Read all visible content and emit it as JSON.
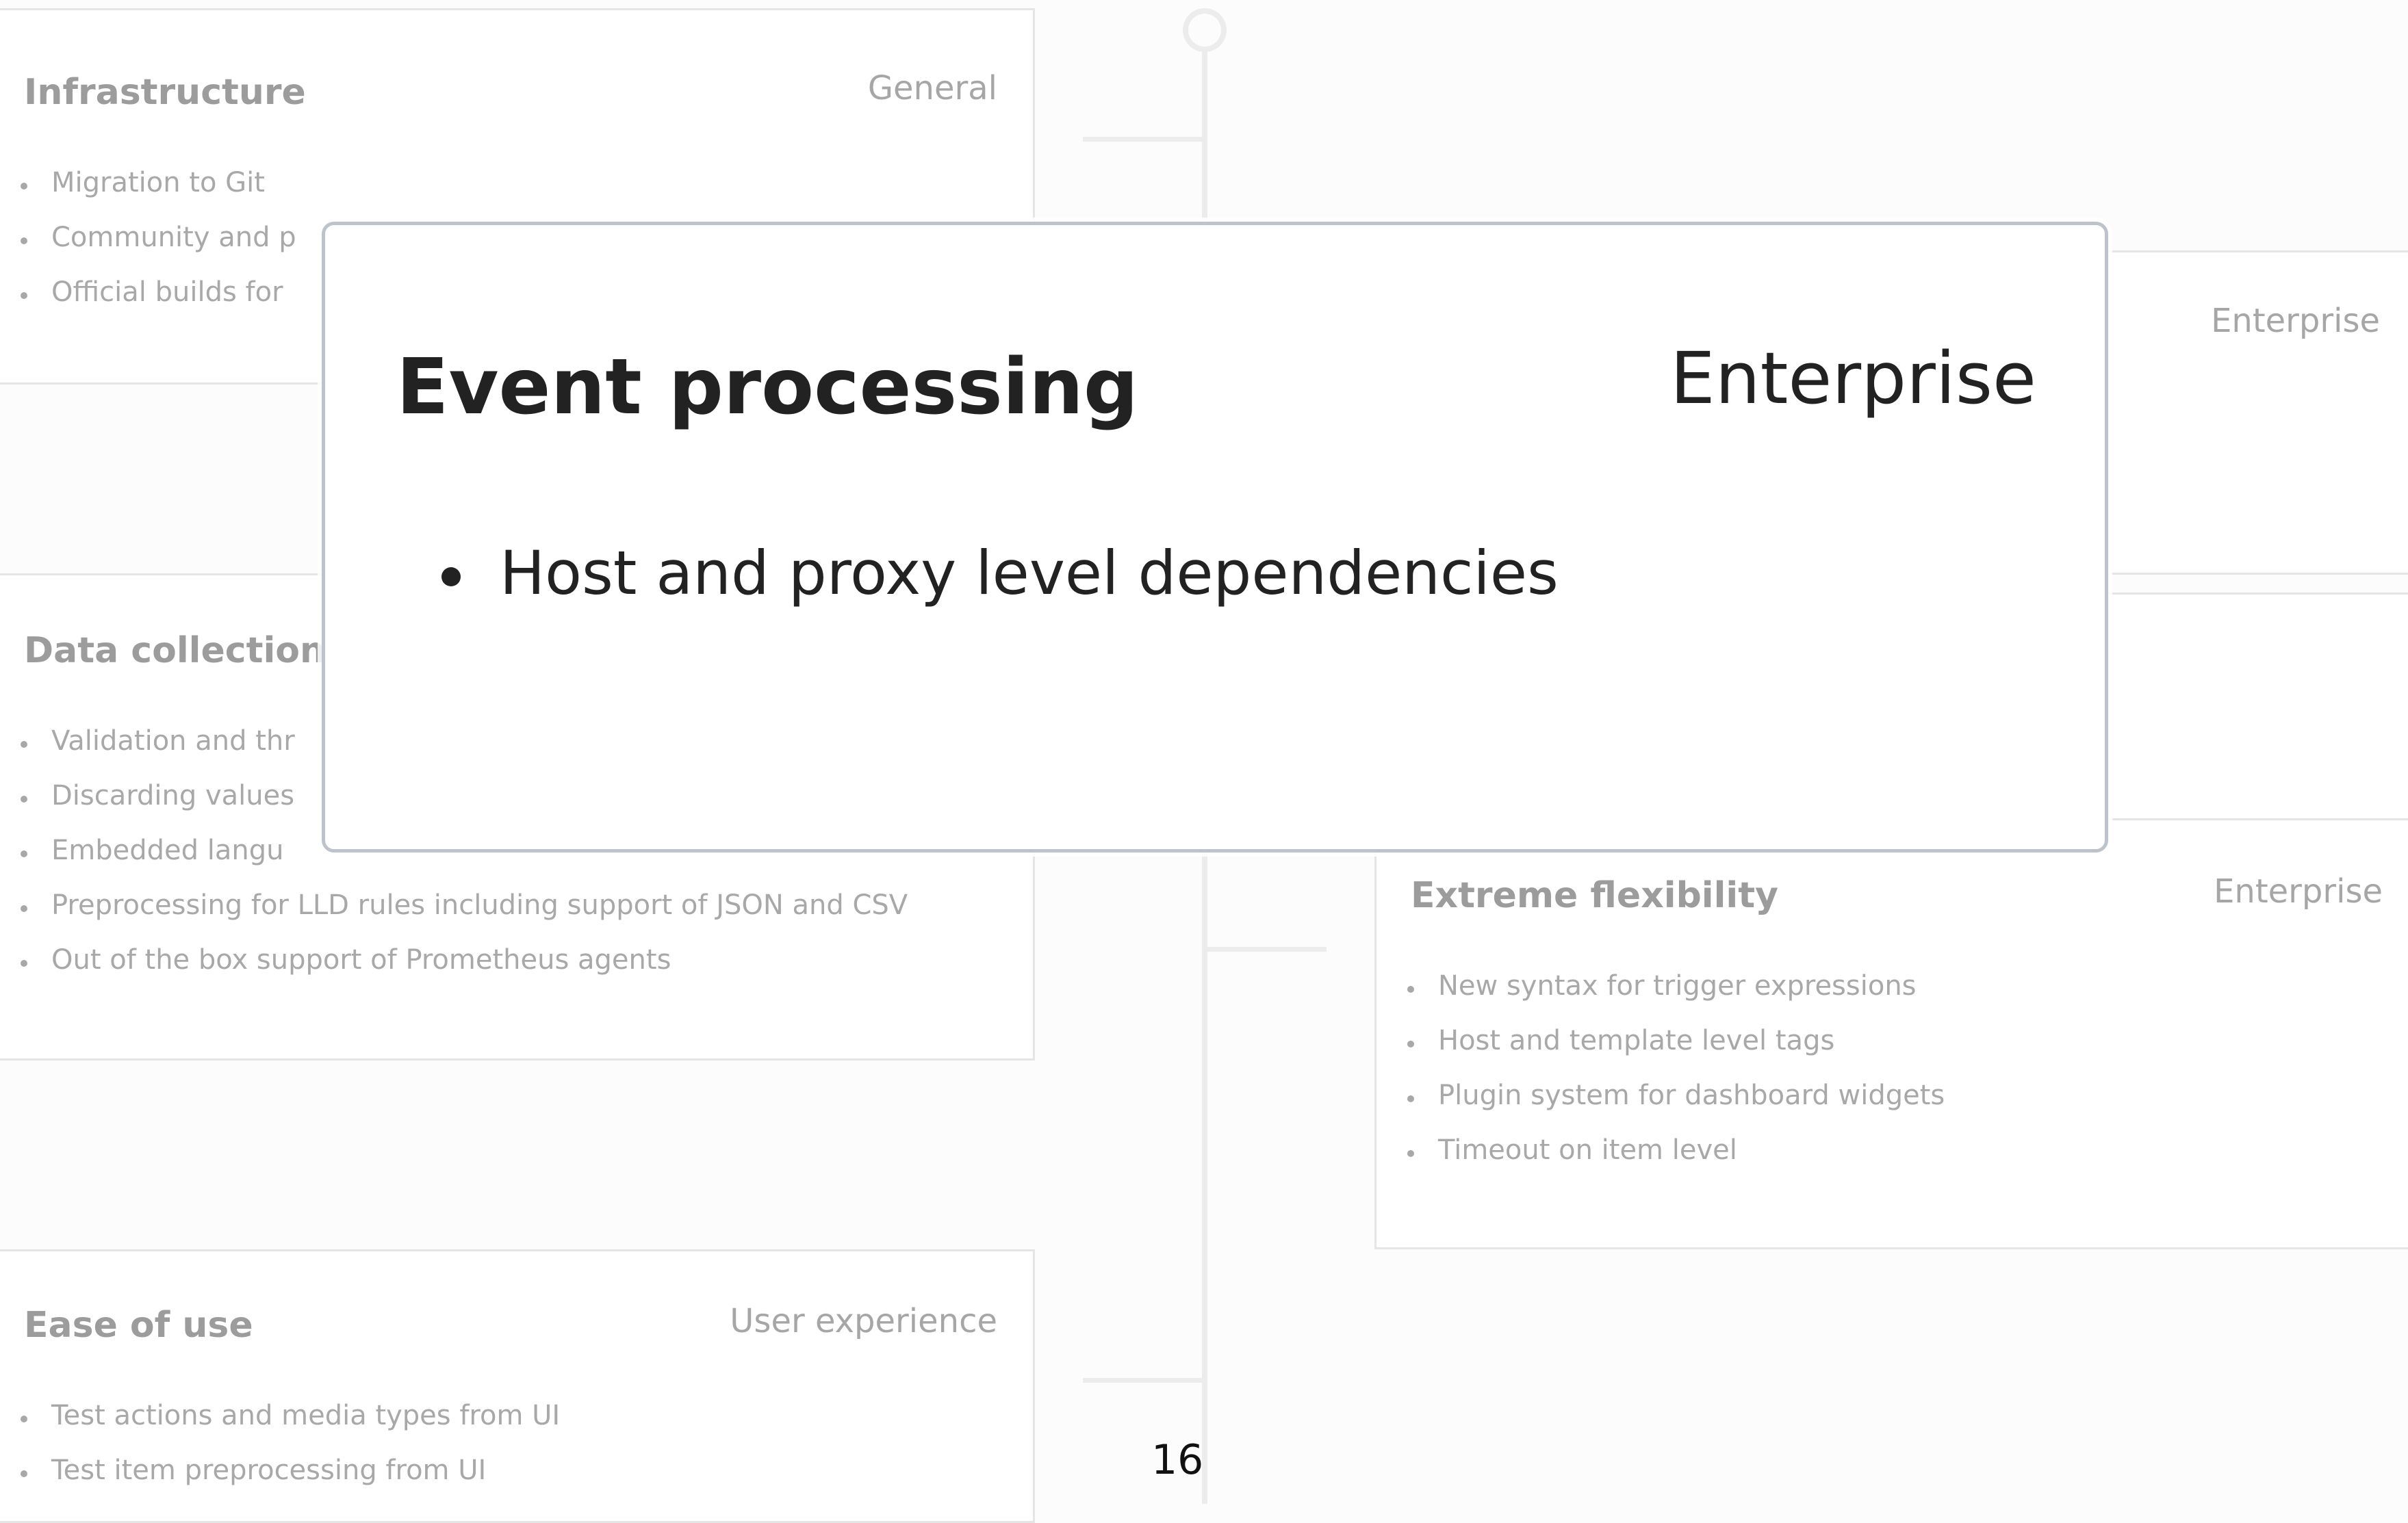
{
  "cards": {
    "infrastructure": {
      "title": "Infrastructure",
      "tag": "General",
      "items": [
        "Migration to Git",
        "Community and p",
        "Official builds for"
      ]
    },
    "data_collection": {
      "title": "Data collection",
      "items": [
        "Validation and thr",
        "Discarding values",
        "Embedded langu",
        "Preprocessing for LLD rules including support of JSON and CSV",
        "Out of the box support of Prometheus agents"
      ]
    },
    "ease_of_use": {
      "title": "Ease of use",
      "tag": "User experience",
      "items": [
        "Test actions and media types from UI",
        "Test item preprocessing from UI"
      ]
    },
    "enterprise_top": {
      "tag": "Enterprise"
    },
    "extreme_flexibility": {
      "title": "Extreme flexibility",
      "tag": "Enterprise",
      "items": [
        "New syntax for trigger expressions",
        "Host and template level tags",
        "Plugin system for dashboard widgets",
        "Timeout on item level"
      ]
    }
  },
  "modal": {
    "title": "Event processing",
    "tag": "Enterprise",
    "items": [
      "Host and proxy level dependencies"
    ]
  },
  "page_number": "16"
}
